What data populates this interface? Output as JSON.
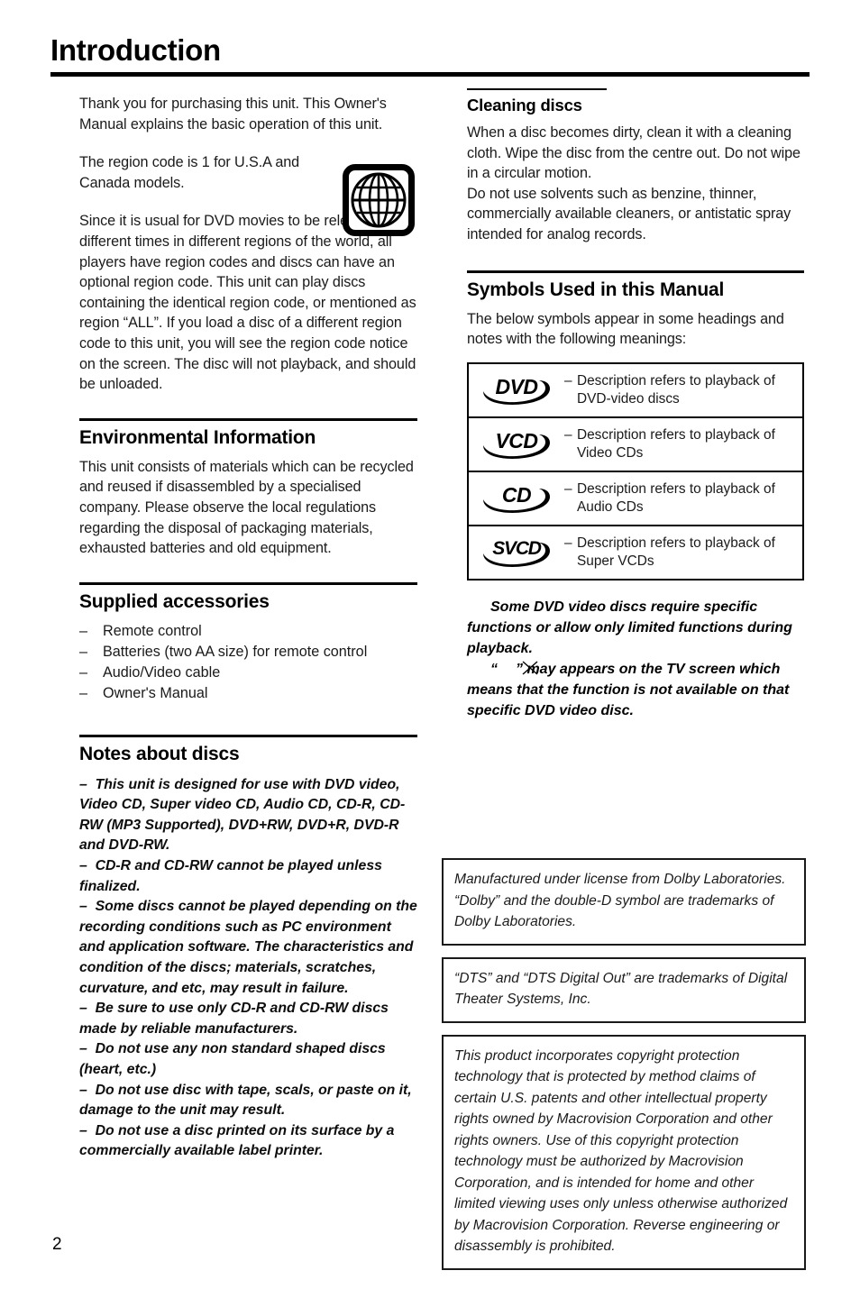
{
  "page": {
    "title": "Introduction",
    "page_number": "2"
  },
  "left_column": {
    "intro_paragraph": "Thank you for purchasing this unit. This Owner's Manual explains the basic operation of this unit.",
    "region_paragraph": "The region code is 1 for U.S.A and Canada models.",
    "region_icon": "globe-icon",
    "region_detail_paragraph": "Since it is usual for DVD movies to be released at different times in different regions of the world, all players have region codes and discs can have an optional region code. This unit can play discs containing the identical region code, or mentioned as region “ALL”. If you load a disc of a different region code to this unit, you will see the region code notice on the screen. The disc will not playback, and should be unloaded.",
    "environmental": {
      "heading": "Environmental Information",
      "body": "This unit consists of materials which can be recycled and reused if disassembled by a specialised company. Please observe the local regulations regarding the disposal of packaging materials, exhausted batteries and old equipment."
    },
    "supplied_accessories": {
      "heading": "Supplied accessories",
      "items": [
        "Remote control",
        "Batteries (two AA size) for remote control",
        "Audio/Video cable",
        "Owner's Manual"
      ]
    },
    "notes_about_discs": {
      "heading": "Notes about discs",
      "items": [
        "This unit is designed for use with DVD video, Video CD, Super video CD, Audio CD, CD-R, CD-RW (MP3 Supported), DVD+RW, DVD+R, DVD-R and DVD-RW.",
        "CD-R and CD-RW cannot be played unless finalized.",
        "Some discs cannot be played depending on the recording conditions such as PC environment and application software.  The characteristics and condition of the discs; materials, scratches, curvature, and etc, may result in failure.",
        "Be sure to use only CD-R and CD-RW discs made by reliable manufacturers.",
        "Do not use any non standard shaped discs (heart, etc.)",
        "Do not use disc with tape, scals, or paste on it, damage to the unit may result.",
        "Do not use a disc printed on its surface by a commercially available label printer."
      ]
    }
  },
  "right_column": {
    "cleaning_discs": {
      "heading": "Cleaning discs",
      "body": "When a disc becomes dirty, clean it with a cleaning cloth. Wipe the disc from the centre out. Do not wipe in a circular motion.\nDo not use solvents such as benzine, thinner, commercially available cleaners, or antistatic spray intended for analog records."
    },
    "symbols_section": {
      "heading": "Symbols Used in this Manual",
      "intro": "The below symbols appear in some headings and notes with the following meanings:",
      "rows": [
        {
          "icon": "dvd-disc-logo",
          "logo_text": "DVD",
          "dash": "–",
          "description_line1": "Description refers to playback of",
          "description_line2": "DVD-video discs"
        },
        {
          "icon": "vcd-disc-logo",
          "logo_text": "VCD",
          "dash": "–",
          "description_line1": "Description refers to playback of",
          "description_line2": "Video CDs"
        },
        {
          "icon": "cd-disc-logo",
          "logo_text": "CD",
          "dash": "–",
          "description_line1": "Description refers to playback of",
          "description_line2": "Audio CDs"
        },
        {
          "icon": "svcd-disc-logo",
          "logo_text": "SVCD",
          "dash": "–",
          "description_line1": "Description refers to playback of",
          "description_line2": "Super VCDs"
        }
      ],
      "note_para1": "Some DVD video discs require specific functions or allow only limited functions during playback.",
      "note_quote_open": "“",
      "note_quote_close": "”",
      "note_para2_rest": " may appears on the TV screen which means that the function is not available on that specific DVD video disc."
    },
    "license_boxes": [
      "Manufactured under license from Dolby Laboratories. “Dolby” and the double-D symbol are trademarks of Dolby Laboratories.",
      "“DTS” and “DTS Digital Out” are trademarks of Digital Theater Systems, Inc.",
      "This product incorporates copyright protection technology that is protected by method claims of certain U.S. patents and other intellectual property rights owned by Macrovision Corporation and other rights owners. Use of this copyright protection technology must be authorized by Macrovision Corporation, and is intended for home and other limited viewing uses only unless otherwise authorized by Macrovision Corporation. Reverse engineering or disassembly is prohibited."
    ]
  },
  "colors": {
    "ink": "#000000",
    "body_ink": "#1a1a1a",
    "paper": "#ffffff"
  }
}
